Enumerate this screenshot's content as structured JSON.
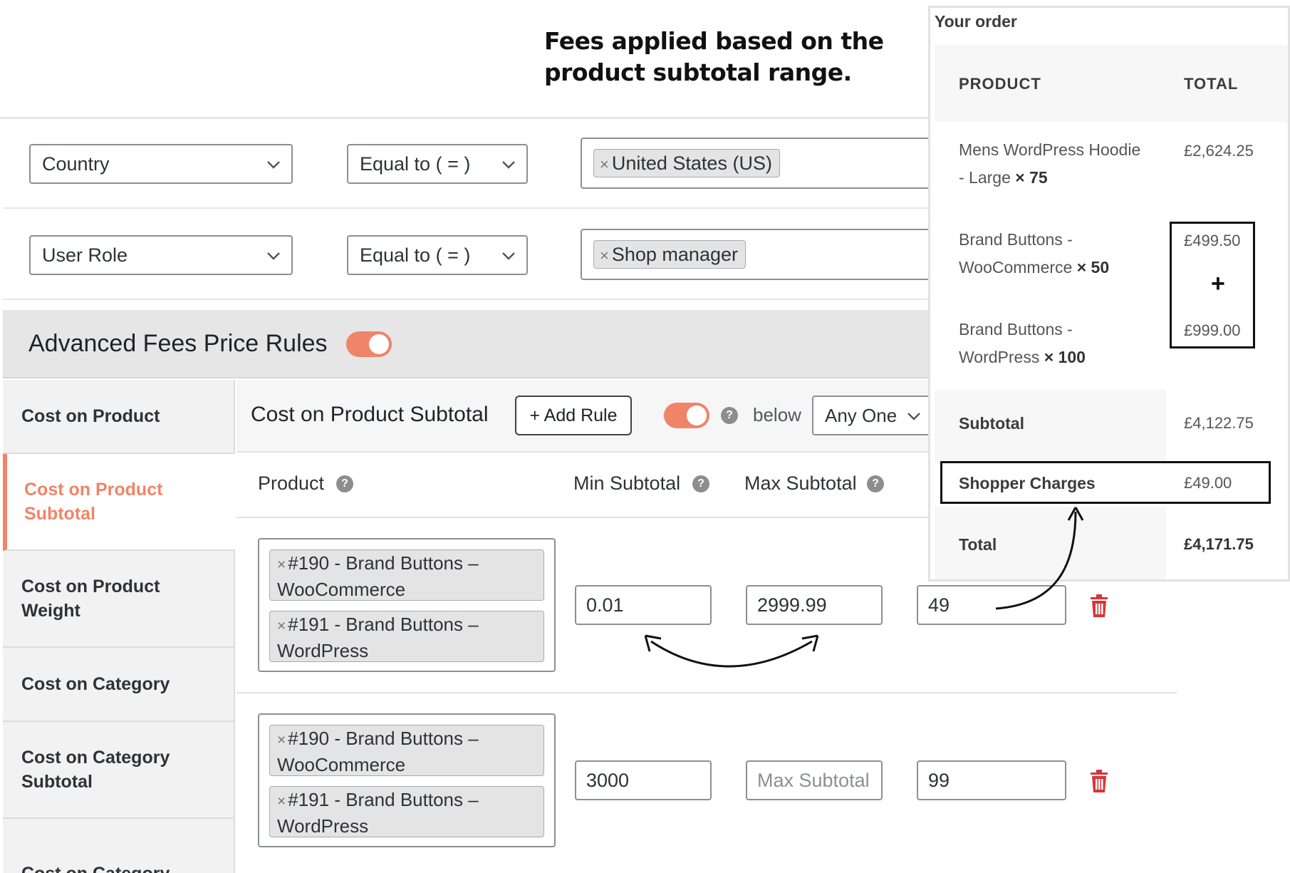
{
  "heading": "Fees applied based on the product subtotal range.",
  "conditions": [
    {
      "field": "Country",
      "operator": "Equal to ( = )",
      "value_tag": "United States (US)"
    },
    {
      "field": "User Role",
      "operator": "Equal to ( = )",
      "value_tag": "Shop manager"
    }
  ],
  "advanced": {
    "title": "Advanced Fees Price Rules",
    "enabled": true
  },
  "tabs": [
    {
      "label": "Cost on Product"
    },
    {
      "label": "Cost on Product Subtotal",
      "active": true
    },
    {
      "label": "Cost on Product Weight"
    },
    {
      "label": "Cost on Category"
    },
    {
      "label": "Cost on Category Subtotal"
    },
    {
      "label": "Cost on Category"
    }
  ],
  "panel": {
    "title": "Cost on Product Subtotal",
    "add_rule": "+ Add Rule",
    "help_glyph": "?",
    "below_text": "below",
    "apply_select": "Any One",
    "columns": {
      "product": "Product",
      "min": "Min Subtotal",
      "max": "Max Subtotal"
    },
    "rules": [
      {
        "products": [
          "#190 - Brand Buttons – WooCommerce",
          "#191 - Brand Buttons – WordPress"
        ],
        "min": "0.01",
        "max": "2999.99",
        "max_placeholder": "",
        "fee": "49"
      },
      {
        "products": [
          "#190 - Brand Buttons – WooCommerce",
          "#191 - Brand Buttons – WordPress"
        ],
        "min": "3000",
        "max": "",
        "max_placeholder": "Max Subtotal",
        "fee": "99"
      }
    ]
  },
  "order": {
    "title": "Your order",
    "col_product": "PRODUCT",
    "col_total": "TOTAL",
    "items": [
      {
        "line1": "Mens WordPress Hoodie",
        "line2": "- Large",
        "qty": "× 75",
        "price": "£2,624.25"
      },
      {
        "line1": "Brand Buttons -",
        "line2": "WooCommerce",
        "qty": "× 50",
        "price": "£499.50"
      },
      {
        "line1": "Brand Buttons -",
        "line2": "WordPress",
        "qty": "× 100",
        "price": "£999.00"
      }
    ],
    "plus": "+",
    "subtotal_label": "Subtotal",
    "subtotal": "£4,122.75",
    "charges_label": "Shopper Charges",
    "charges": "£49.00",
    "total_label": "Total",
    "total": "£4,171.75"
  },
  "colors": {
    "accent": "#f08469",
    "danger": "#d63638",
    "border": "#8c8f94"
  }
}
